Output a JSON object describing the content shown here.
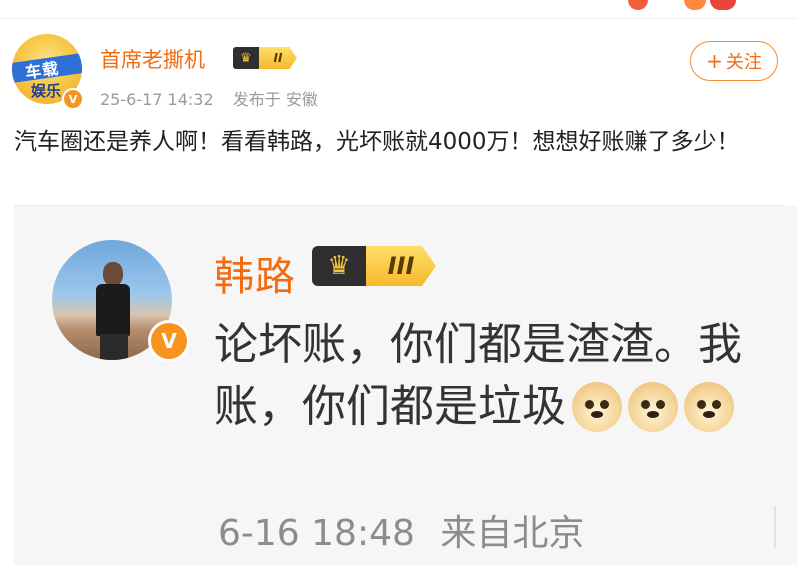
{
  "post": {
    "author": {
      "name": "首席老撕机",
      "level": "II",
      "avatar_text": "车载娱乐"
    },
    "time": "25-6-17 14:32",
    "location": "发布于 安徽",
    "follow_label": "关注",
    "text": "汽车圈还是养人啊！看看韩路，光坏账就4000万！想想好账赚了多少！"
  },
  "screenshot": {
    "author": {
      "name": "韩路",
      "level": "III"
    },
    "text_line1": "论坏账，你们都是渣渣。我",
    "text_line2": "账，你们都是垃圾",
    "time": "6-16 18:48",
    "location": "来自北京"
  },
  "colors": {
    "accent_orange": "#f26b0f",
    "meta_gray": "#9a9a9a",
    "verified_badge": "#f7931e"
  },
  "icons": {
    "verified": "v-badge-icon",
    "crown": "crown-icon",
    "emoji": "doge-emoji-icon"
  }
}
